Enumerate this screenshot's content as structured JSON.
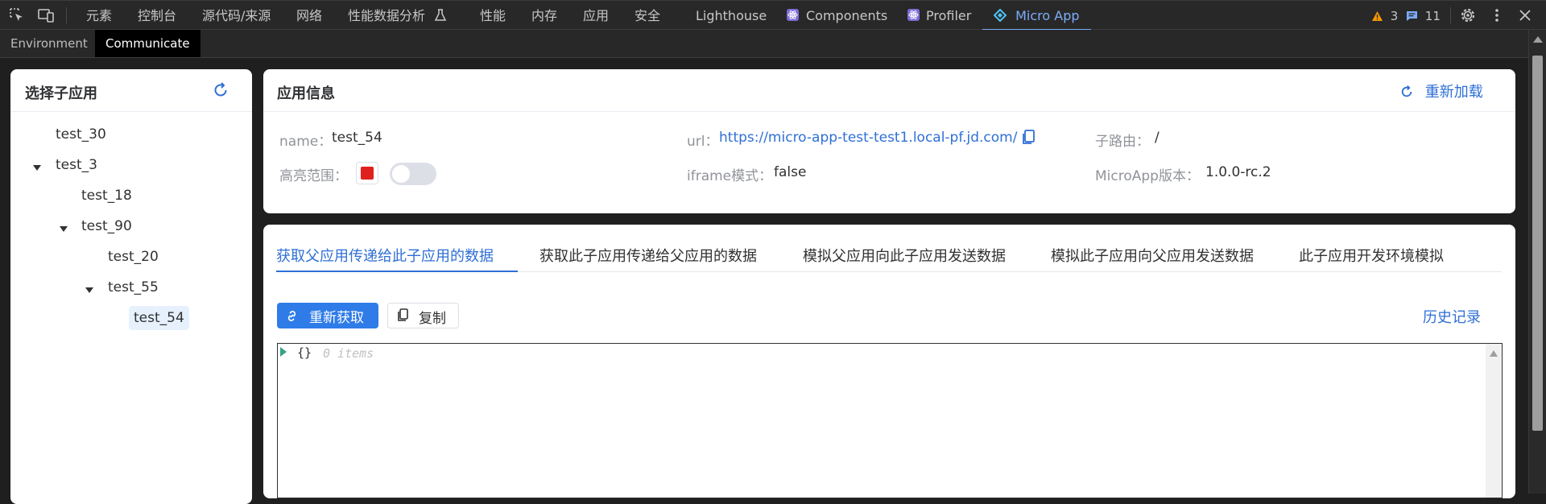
{
  "devtools": {
    "tabs": [
      "元素",
      "控制台",
      "源代码/来源",
      "网络",
      "性能数据分析",
      "性能",
      "内存",
      "应用",
      "安全",
      "Lighthouse",
      "Components",
      "Profiler",
      "Micro App"
    ],
    "active_tab": "Micro App",
    "warnings_count": "3",
    "messages_count": "11",
    "icons": [
      "inspect-element-icon",
      "device-toolbar-icon",
      "flask-icon",
      "react-icon",
      "micro-app-icon",
      "warning-icon",
      "message-icon",
      "gear-icon",
      "more-vert-icon",
      "close-icon"
    ]
  },
  "subtabs": {
    "items": [
      "Environment",
      "Communicate"
    ],
    "active": "Communicate"
  },
  "left_panel": {
    "title": "选择子应用",
    "tree": [
      {
        "label": "test_30",
        "depth": 0,
        "expanded": false
      },
      {
        "label": "test_3",
        "depth": 0,
        "expanded": true
      },
      {
        "label": "test_18",
        "depth": 1,
        "expanded": false
      },
      {
        "label": "test_90",
        "depth": 1,
        "expanded": true
      },
      {
        "label": "test_20",
        "depth": 2,
        "expanded": false
      },
      {
        "label": "test_55",
        "depth": 2,
        "expanded": true
      },
      {
        "label": "test_54",
        "depth": 3,
        "expanded": false,
        "selected": true
      }
    ]
  },
  "app_info": {
    "title": "应用信息",
    "reload_label": "重新加载",
    "name_label": "name：",
    "name_value": "test_54",
    "url_label": "url：",
    "url_value": "https://micro-app-test-test1.local-pf.jd.com/",
    "route_label": "子路由：",
    "route_value": "/",
    "highlight_label": "高亮范围：",
    "highlight_color": "#e0201d",
    "highlight_enabled": false,
    "iframe_label": "iframe模式：",
    "iframe_value": "false",
    "version_label": "MicroApp版本：",
    "version_value": "1.0.0-rc.2"
  },
  "data_panel": {
    "tabs": [
      "获取父应用传递给此子应用的数据",
      "获取此子应用传递给父应用的数据",
      "模拟父应用向此子应用发送数据",
      "模拟此子应用向父应用发送数据",
      "此子应用开发环境模拟"
    ],
    "active_tab": 0,
    "refetch_label": "重新获取",
    "copy_label": "复制",
    "history_label": "历史记录",
    "json_brace": "{}",
    "json_count": "0 items"
  },
  "colors": {
    "accent": "#2f6fd6",
    "primary_button": "#2f7ce8",
    "devtools_active": "#7cacf8"
  }
}
